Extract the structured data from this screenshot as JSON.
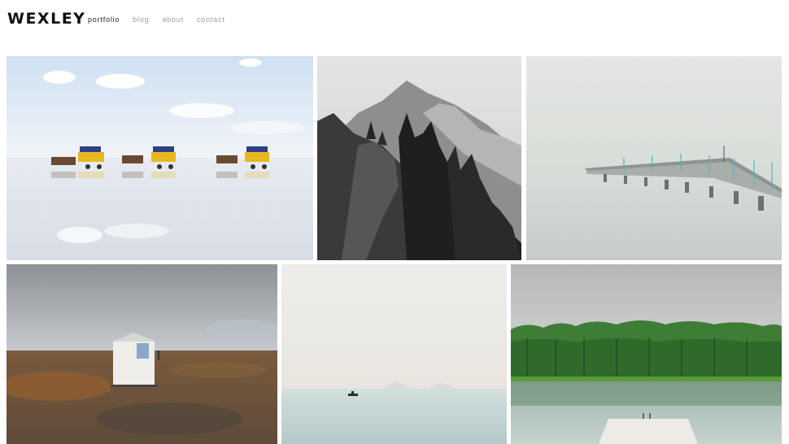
{
  "site": {
    "logo": "WEXLEY"
  },
  "nav": {
    "items": [
      {
        "label": "portfolio",
        "active": true
      },
      {
        "label": "blog",
        "active": false
      },
      {
        "label": "about",
        "active": false
      },
      {
        "label": "contact",
        "active": false
      }
    ]
  },
  "colors": {
    "text": "#111111",
    "nav_muted": "#9a9a9a",
    "nav_active": "#222222",
    "background": "#ffffff"
  },
  "gallery": {
    "photos": [
      {
        "name": "horse-carriages-on-tidal-flat"
      },
      {
        "name": "black-and-white-mountain-cliffs"
      },
      {
        "name": "pier-in-fog"
      },
      {
        "name": "white-hut-on-rocky-field"
      },
      {
        "name": "boat-on-calm-sea"
      },
      {
        "name": "forest-lake-platform"
      }
    ]
  }
}
